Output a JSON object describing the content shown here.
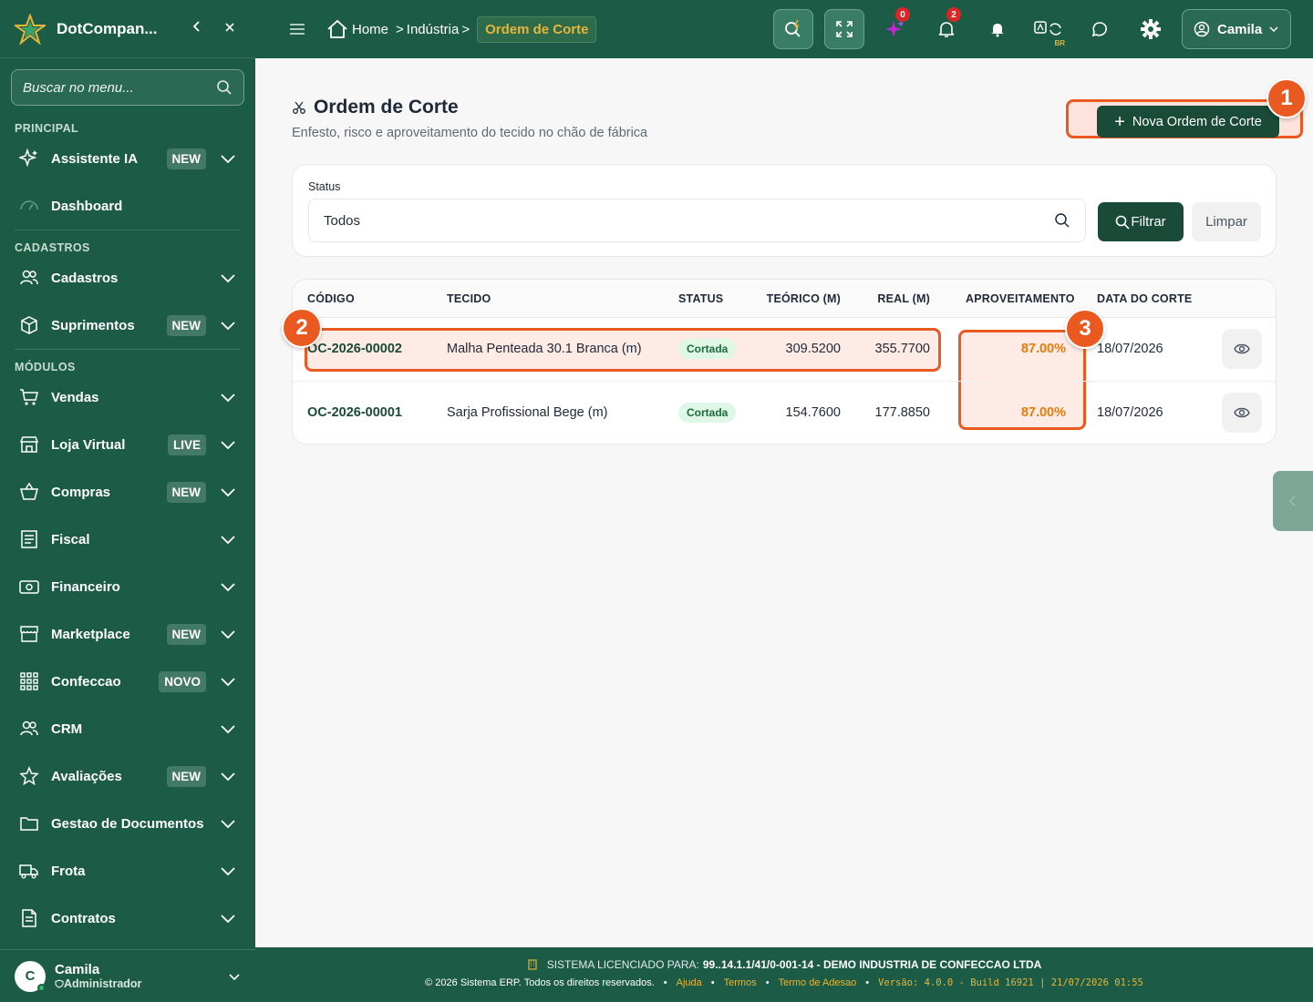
{
  "sidebar": {
    "brand": "DotCompan...",
    "search_placeholder": "Buscar no menu...",
    "sections": {
      "principal": "PRINCIPAL",
      "cadastros": "CADASTROS",
      "modulos": "MÓDULOS"
    },
    "items": [
      {
        "label": "Assistente IA",
        "badge": "NEW",
        "icon": "sparkle-icon"
      },
      {
        "label": "Dashboard",
        "badge": "",
        "icon": "gauge-icon"
      },
      {
        "label": "Cadastros",
        "badge": "",
        "icon": "users-icon"
      },
      {
        "label": "Suprimentos",
        "badge": "NEW",
        "icon": "box-icon"
      },
      {
        "label": "Vendas",
        "badge": "",
        "icon": "cart-icon"
      },
      {
        "label": "Loja Virtual",
        "badge": "LIVE",
        "icon": "store-icon"
      },
      {
        "label": "Compras",
        "badge": "NEW",
        "icon": "basket-icon"
      },
      {
        "label": "Fiscal",
        "badge": "",
        "icon": "receipt-icon"
      },
      {
        "label": "Financeiro",
        "badge": "",
        "icon": "money-icon"
      },
      {
        "label": "Marketplace",
        "badge": "NEW",
        "icon": "shop-icon"
      },
      {
        "label": "Confeccao",
        "badge": "NOVO",
        "icon": "grid-icon"
      },
      {
        "label": "CRM",
        "badge": "",
        "icon": "people-icon"
      },
      {
        "label": "Avaliações",
        "badge": "NEW",
        "icon": "star-icon"
      },
      {
        "label": "Gestao de Documentos",
        "badge": "",
        "icon": "folder-icon"
      },
      {
        "label": "Frota",
        "badge": "",
        "icon": "truck-icon"
      },
      {
        "label": "Contratos",
        "badge": "",
        "icon": "document-icon"
      }
    ],
    "user": {
      "initial": "C",
      "name": "Camila",
      "role": "Administrador"
    }
  },
  "topbar": {
    "breadcrumb": {
      "home": "Home",
      "parent": "Indústria",
      "current": "Ordem de Corte"
    },
    "ai_count": "0",
    "notif_count": "2",
    "lang": "BR",
    "user": "Camila"
  },
  "page": {
    "title": "Ordem de Corte",
    "subtitle": "Enfesto, risco e aproveitamento do tecido no chão de fábrica",
    "new_button": "Nova Ordem de Corte"
  },
  "filter": {
    "label": "Status",
    "value": "Todos",
    "filter_button": "Filtrar",
    "clear_button": "Limpar"
  },
  "table": {
    "headers": {
      "codigo": "CÓDIGO",
      "tecido": "TECIDO",
      "status": "STATUS",
      "teorico": "TEÓRICO (M)",
      "real": "REAL (M)",
      "aproveitamento": "APROVEITAMENTO",
      "data": "DATA DO CORTE"
    },
    "rows": [
      {
        "codigo": "OC-2026-00002",
        "tecido": "Malha Penteada 30.1 Branca (m)",
        "status": "Cortada",
        "teorico": "309.5200",
        "real": "355.7700",
        "aproveitamento": "87.00%",
        "data": "18/07/2026"
      },
      {
        "codigo": "OC-2026-00001",
        "tecido": "Sarja Profissional Bege (m)",
        "status": "Cortada",
        "teorico": "154.7600",
        "real": "177.8850",
        "aproveitamento": "87.00%",
        "data": "18/07/2026"
      }
    ]
  },
  "markers": [
    "1",
    "2",
    "3"
  ],
  "footer": {
    "license_prefix": "SISTEMA LICENCIADO PARA:",
    "license_value": "99..14.1.1/41/0-001-14 - DEMO INDUSTRIA DE CONFECCAO LTDA",
    "copyright": "© 2026 Sistema ERP. Todos os direitos reservados.",
    "links": [
      "Ajuda",
      "Termos",
      "Termo de Adesao"
    ],
    "version": "Versão: 4.0.0 - Build 16921 | 21/07/2026 01:55"
  },
  "colors": {
    "primary": "#1c5c46",
    "dark_button": "#1a4a38",
    "accent": "#e5b53a",
    "highlight": "#ea5a20",
    "percent": "#ea7a0a"
  }
}
